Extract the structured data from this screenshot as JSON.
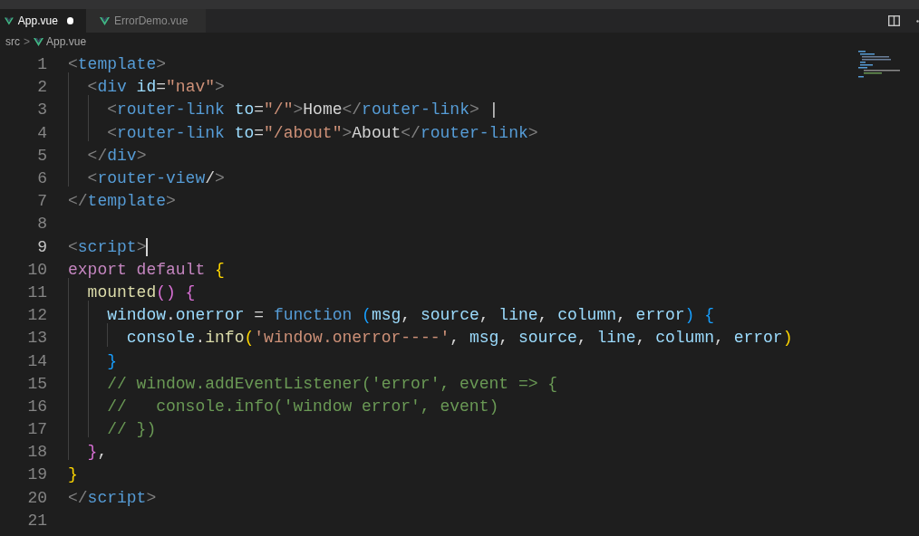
{
  "tabs": [
    {
      "label": "App.vue",
      "selected": true,
      "dirty": true
    },
    {
      "label": "ErrorDemo.vue",
      "selected": false,
      "dirty": false
    }
  ],
  "breadcrumb": {
    "folder": "src",
    "separator": ">",
    "file": "App.vue"
  },
  "editor": {
    "lines": [
      {
        "number": "1",
        "active": false,
        "tokens": [
          {
            "kind": "punct",
            "text": "<"
          },
          {
            "kind": "tag",
            "text": "template"
          },
          {
            "kind": "punct",
            "text": ">"
          }
        ]
      },
      {
        "number": "2",
        "active": false,
        "tokens": [
          {
            "kind": "punct",
            "text": "  <"
          },
          {
            "kind": "tag",
            "text": "div"
          },
          {
            "kind": "attr",
            "text": " id"
          },
          {
            "kind": "text",
            "text": "="
          },
          {
            "kind": "string",
            "text": "\"nav\""
          },
          {
            "kind": "punct",
            "text": ">"
          }
        ]
      },
      {
        "number": "3",
        "active": false,
        "tokens": [
          {
            "kind": "punct",
            "text": "    <"
          },
          {
            "kind": "tag",
            "text": "router-link"
          },
          {
            "kind": "attr",
            "text": " to"
          },
          {
            "kind": "text",
            "text": "="
          },
          {
            "kind": "string",
            "text": "\"/\""
          },
          {
            "kind": "punct",
            "text": ">"
          },
          {
            "kind": "text",
            "text": "Home"
          },
          {
            "kind": "punct",
            "text": "</"
          },
          {
            "kind": "tag",
            "text": "router-link"
          },
          {
            "kind": "punct",
            "text": ">"
          },
          {
            "kind": "text",
            "text": " |"
          }
        ]
      },
      {
        "number": "4",
        "active": false,
        "tokens": [
          {
            "kind": "punct",
            "text": "    <"
          },
          {
            "kind": "tag",
            "text": "router-link"
          },
          {
            "kind": "attr",
            "text": " to"
          },
          {
            "kind": "text",
            "text": "="
          },
          {
            "kind": "string",
            "text": "\"/about\""
          },
          {
            "kind": "punct",
            "text": ">"
          },
          {
            "kind": "text",
            "text": "About"
          },
          {
            "kind": "punct",
            "text": "</"
          },
          {
            "kind": "tag",
            "text": "router-link"
          },
          {
            "kind": "punct",
            "text": ">"
          }
        ]
      },
      {
        "number": "5",
        "active": false,
        "tokens": [
          {
            "kind": "punct",
            "text": "  </"
          },
          {
            "kind": "tag",
            "text": "div"
          },
          {
            "kind": "punct",
            "text": ">"
          }
        ]
      },
      {
        "number": "6",
        "active": false,
        "tokens": [
          {
            "kind": "punct",
            "text": "  <"
          },
          {
            "kind": "tag",
            "text": "router-view"
          },
          {
            "kind": "text",
            "text": "/"
          },
          {
            "kind": "punct",
            "text": ">"
          }
        ]
      },
      {
        "number": "7",
        "active": false,
        "tokens": [
          {
            "kind": "punct",
            "text": "</"
          },
          {
            "kind": "tag",
            "text": "template"
          },
          {
            "kind": "punct",
            "text": ">"
          }
        ]
      },
      {
        "number": "8",
        "active": false
      },
      {
        "number": "9",
        "active": true,
        "tokens": [
          {
            "kind": "punct",
            "text": "<"
          },
          {
            "kind": "tag",
            "text": "script"
          },
          {
            "kind": "punct",
            "text": ">"
          }
        ]
      },
      {
        "number": "10",
        "active": false,
        "tokens": [
          {
            "kind": "keyword",
            "text": "export default"
          },
          {
            "kind": "brace1",
            "text": " {"
          }
        ]
      },
      {
        "number": "11",
        "active": false,
        "tokens": [
          {
            "kind": "function",
            "text": "  mounted"
          },
          {
            "kind": "brace2",
            "text": "() {"
          }
        ]
      },
      {
        "number": "12",
        "active": false,
        "tokens": [
          {
            "kind": "variable",
            "text": "    window"
          },
          {
            "kind": "text",
            "text": "."
          },
          {
            "kind": "variable",
            "text": "onerror"
          },
          {
            "kind": "text",
            "text": " = "
          },
          {
            "kind": "storage",
            "text": "function"
          },
          {
            "kind": "brace3",
            "text": " ("
          },
          {
            "kind": "variable",
            "text": "msg"
          },
          {
            "kind": "text",
            "text": ", "
          },
          {
            "kind": "variable",
            "text": "source"
          },
          {
            "kind": "text",
            "text": ", "
          },
          {
            "kind": "variable",
            "text": "line"
          },
          {
            "kind": "text",
            "text": ", "
          },
          {
            "kind": "variable",
            "text": "column"
          },
          {
            "kind": "text",
            "text": ", "
          },
          {
            "kind": "variable",
            "text": "error"
          },
          {
            "kind": "brace3",
            "text": ") {"
          }
        ]
      },
      {
        "number": "13",
        "active": false,
        "tokens": [
          {
            "kind": "variable",
            "text": "      console"
          },
          {
            "kind": "text",
            "text": "."
          },
          {
            "kind": "function",
            "text": "info"
          },
          {
            "kind": "brace1",
            "text": "("
          },
          {
            "kind": "string",
            "text": "'window.onerror----'"
          },
          {
            "kind": "text",
            "text": ", "
          },
          {
            "kind": "variable",
            "text": "msg"
          },
          {
            "kind": "text",
            "text": ", "
          },
          {
            "kind": "variable",
            "text": "source"
          },
          {
            "kind": "text",
            "text": ", "
          },
          {
            "kind": "variable",
            "text": "line"
          },
          {
            "kind": "text",
            "text": ", "
          },
          {
            "kind": "variable",
            "text": "column"
          },
          {
            "kind": "text",
            "text": ", "
          },
          {
            "kind": "variable",
            "text": "error"
          },
          {
            "kind": "brace1",
            "text": ")"
          }
        ]
      },
      {
        "number": "14",
        "active": false,
        "tokens": [
          {
            "kind": "brace3",
            "text": "    }"
          }
        ]
      },
      {
        "number": "15",
        "active": false,
        "tokens": [
          {
            "kind": "comment",
            "text": "    // window.addEventListener('error', event => {"
          }
        ]
      },
      {
        "number": "16",
        "active": false,
        "tokens": [
          {
            "kind": "comment",
            "text": "    //   console.info('window error', event)"
          }
        ]
      },
      {
        "number": "17",
        "active": false,
        "tokens": [
          {
            "kind": "comment",
            "text": "    // })"
          }
        ]
      },
      {
        "number": "18",
        "active": false,
        "tokens": [
          {
            "kind": "brace2",
            "text": "  }"
          },
          {
            "kind": "text",
            "text": ","
          }
        ]
      },
      {
        "number": "19",
        "active": false,
        "tokens": [
          {
            "kind": "brace1",
            "text": "}"
          }
        ]
      },
      {
        "number": "20",
        "active": false,
        "tokens": [
          {
            "kind": "punct",
            "text": "</"
          },
          {
            "kind": "tag",
            "text": "script"
          },
          {
            "kind": "punct",
            "text": ">"
          }
        ]
      },
      {
        "number": "21",
        "active": false
      }
    ]
  }
}
